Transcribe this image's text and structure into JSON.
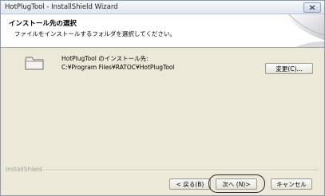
{
  "window": {
    "title": "HotPlugTool - InstallShield Wizard"
  },
  "header": {
    "title": "インストール先の選択",
    "subtitle": "ファイルをインストールするフォルダを選択してください。"
  },
  "destination": {
    "label": "HotPlugTool のインストール先:",
    "path": "C:¥Program Files¥RATOC¥HotPlugTool",
    "change_button": "変更(C)..."
  },
  "footer": {
    "brand": "InstallShield",
    "back_button": "< 戻る(B)",
    "next_button": "次へ (N)>",
    "cancel_button": "キャンセル"
  },
  "icons": {
    "close": "close-icon",
    "folder": "folder-icon",
    "header_art": "installshield-art-icon"
  }
}
